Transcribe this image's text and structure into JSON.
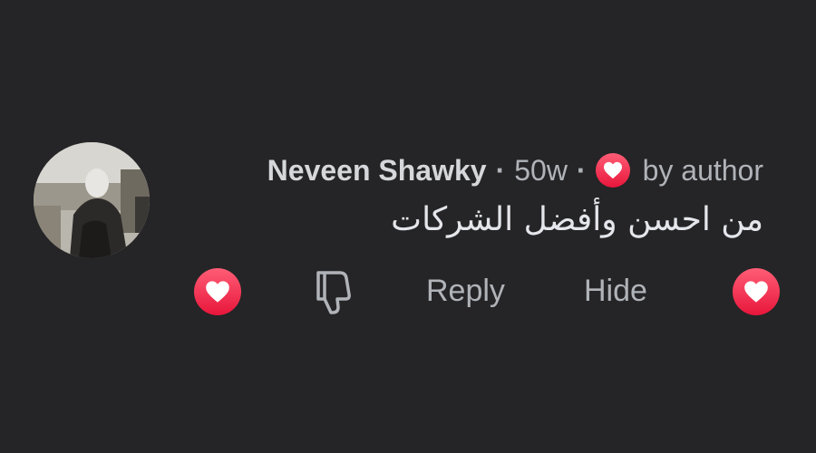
{
  "comment": {
    "author": "Neveen Shawky",
    "separator": "·",
    "time": "50w",
    "liked_by": "by author",
    "text": "من احسن وأفضل الشركات"
  },
  "actions": {
    "reply_label": "Reply",
    "hide_label": "Hide"
  },
  "icons": {
    "reaction": "heart-icon",
    "dislike": "thumbs-down-icon"
  },
  "colors": {
    "background": "#252527",
    "heart": "#f02849",
    "secondary_text": "#b0b3b8",
    "primary_text": "#e4e6eb"
  }
}
